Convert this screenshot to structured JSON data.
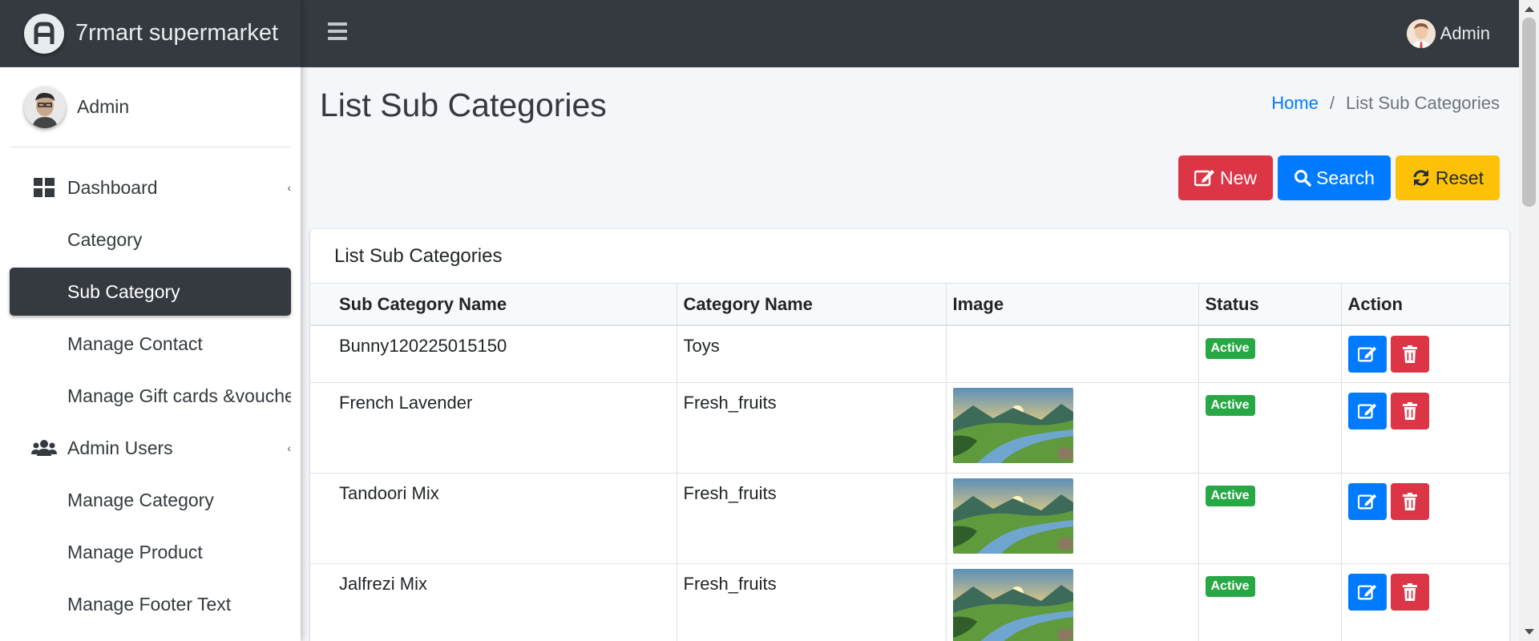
{
  "brand": {
    "name": "7rmart supermarket"
  },
  "topbar": {
    "user_name": "Admin"
  },
  "sidebar": {
    "user_name": "Admin",
    "items": [
      {
        "label": "Dashboard",
        "icon": "dashboard-icon"
      },
      {
        "label": "Category"
      },
      {
        "label": "Sub Category",
        "active": true
      },
      {
        "label": "Manage Contact"
      },
      {
        "label": "Manage Gift cards &voucher"
      },
      {
        "label": "Admin Users",
        "icon": "users-icon"
      },
      {
        "label": "Manage Category"
      },
      {
        "label": "Manage Product"
      },
      {
        "label": "Manage Footer Text"
      }
    ]
  },
  "page": {
    "title": "List Sub Categories",
    "breadcrumb": {
      "home": "Home",
      "current": "List Sub Categories"
    }
  },
  "buttons": {
    "new": "New",
    "search": "Search",
    "reset": "Reset"
  },
  "card": {
    "title": "List Sub Categories"
  },
  "table": {
    "headers": [
      "Sub Category Name",
      "Category Name",
      "Image",
      "Status",
      "Action"
    ],
    "rows": [
      {
        "sub_category": "Bunny120225015150",
        "category": "Toys",
        "has_image": false,
        "status": "Active"
      },
      {
        "sub_category": "French Lavender",
        "category": "Fresh_fruits",
        "has_image": true,
        "status": "Active"
      },
      {
        "sub_category": "Tandoori Mix",
        "category": "Fresh_fruits",
        "has_image": true,
        "status": "Active"
      },
      {
        "sub_category": "Jalfrezi Mix",
        "category": "Fresh_fruits",
        "has_image": true,
        "status": "Active"
      }
    ]
  },
  "colors": {
    "dark": "#343a40",
    "primary": "#007bff",
    "danger": "#dc3545",
    "warning": "#ffc107",
    "success": "#28a745"
  }
}
